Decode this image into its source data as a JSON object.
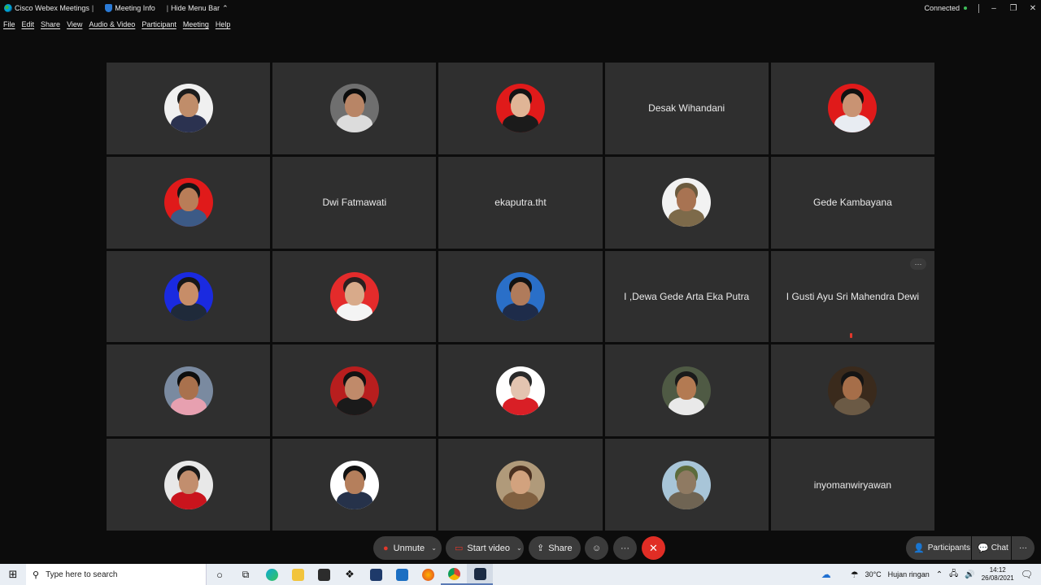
{
  "titlebar": {
    "app_name": "Cisco Webex Meetings",
    "meeting_info": "Meeting Info",
    "hide_menu": "Hide Menu Bar",
    "status": "Connected"
  },
  "menu": [
    "File",
    "Edit",
    "Share",
    "View",
    "Audio & Video",
    "Participant",
    "Meeting",
    "Help"
  ],
  "tiles": [
    {
      "type": "avatar",
      "bg": "#f0f0f0",
      "skin": "#c08d6a",
      "hair": "#1c1c1c",
      "shirt": "#2b3250"
    },
    {
      "type": "avatar",
      "bg": "#6f6f6f",
      "skin": "#b88566",
      "hair": "#0c0c0c",
      "shirt": "#dcdcdc"
    },
    {
      "type": "avatar",
      "bg": "#e01a1a",
      "skin": "#e0b596",
      "hair": "#141414",
      "shirt": "#1b1b1b"
    },
    {
      "type": "name",
      "name": "Desak Wihandani"
    },
    {
      "type": "avatar",
      "bg": "#e01a1a",
      "skin": "#c99373",
      "hair": "#111111",
      "shirt": "#e8ecf2"
    },
    {
      "type": "avatar",
      "bg": "#e01a1a",
      "skin": "#b97d58",
      "hair": "#151515",
      "shirt": "#3c5a86"
    },
    {
      "type": "name",
      "name": "Dwi Fatmawati"
    },
    {
      "type": "name",
      "name": "ekaputra.tht"
    },
    {
      "type": "avatar",
      "bg": "#f2f2f2",
      "skin": "#a87352",
      "hair": "#6b5a3e",
      "shirt": "#7d6a4a"
    },
    {
      "type": "name",
      "name": "Gede Kambayana"
    },
    {
      "type": "avatar",
      "bg": "#1a2ae0",
      "skin": "#c78d68",
      "hair": "#171717",
      "shirt": "#1f2a3a"
    },
    {
      "type": "avatar",
      "bg": "#e42b2b",
      "skin": "#d8aa8a",
      "hair": "#2a2020",
      "shirt": "#f4f4f4"
    },
    {
      "type": "avatar",
      "bg": "#2a6fc8",
      "skin": "#b07b5b",
      "hair": "#121212",
      "shirt": "#1e2c4a"
    },
    {
      "type": "name",
      "name": "I ,Dewa Gede Arta Eka Putra"
    },
    {
      "type": "name",
      "name": "I Gusti Ayu Sri Mahendra Dewi",
      "more": true,
      "mic": true
    },
    {
      "type": "avatar",
      "bg": "#7a8aa0",
      "skin": "#a9714d",
      "hair": "#0e0e0e",
      "shirt": "#e7a0b0"
    },
    {
      "type": "avatar",
      "bg": "#b81e1e",
      "skin": "#c08a6a",
      "hair": "#121212",
      "shirt": "#1a1a1a"
    },
    {
      "type": "avatar",
      "bg": "#ffffff",
      "skin": "#e3c4b0",
      "hair": "#2a2a2a",
      "shirt": "#d91f26"
    },
    {
      "type": "avatar",
      "bg": "#4f5a44",
      "skin": "#b37a52",
      "hair": "#1a1a1a",
      "shirt": "#e9e9e9"
    },
    {
      "type": "avatar",
      "bg": "#3a2a1c",
      "skin": "#a66e49",
      "hair": "#141414",
      "shirt": "#6b5a45"
    },
    {
      "type": "avatar",
      "bg": "#e8e8e8",
      "skin": "#c28e6e",
      "hair": "#191919",
      "shirt": "#c9141d"
    },
    {
      "type": "avatar",
      "bg": "#ffffff",
      "skin": "#b57f5c",
      "hair": "#111111",
      "shirt": "#26324a"
    },
    {
      "type": "avatar",
      "bg": "#b09a7a",
      "skin": "#d2a27e",
      "hair": "#4a3020",
      "shirt": "#806040"
    },
    {
      "type": "avatar",
      "bg": "#a8c5d8",
      "skin": "#8f7a62",
      "hair": "#5c6b3b",
      "shirt": "#6f6453"
    },
    {
      "type": "name",
      "name": "inyomanwiryawan"
    }
  ],
  "controls": {
    "unmute": "Unmute",
    "start_video": "Start video",
    "share": "Share",
    "participants": "Participants",
    "chat": "Chat"
  },
  "taskbar": {
    "search_placeholder": "Type here to search",
    "weather": "30°C",
    "weather_desc": "Hujan ringan",
    "time": "14:12",
    "date": "26/08/2021"
  }
}
